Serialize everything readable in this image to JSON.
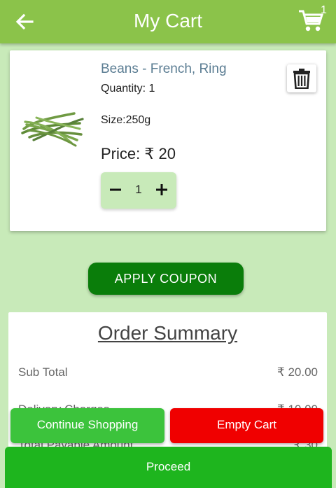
{
  "header": {
    "title": "My Cart",
    "cart_count": "1",
    "back_icon": "arrow-left-icon",
    "cart_icon": "shopping-cart-icon"
  },
  "cart_item": {
    "name": "Beans - French, Ring",
    "quantity_text": "Quantity: 1",
    "size_text": "Size:250g",
    "price_text": "Price: ₹ 20",
    "stepper_value": "1",
    "delete_icon": "trash-icon"
  },
  "coupon": {
    "label": "APPLY COUPON"
  },
  "summary": {
    "title": "Order Summary",
    "rows": [
      {
        "label": "Sub Total",
        "value": "₹ 20.00"
      },
      {
        "label": "Delivery Charges",
        "value": "₹ 10.00"
      },
      {
        "label": "Total Payable Amount",
        "value": "₹ 30"
      }
    ]
  },
  "actions": {
    "continue_label": "Continue Shopping",
    "empty_label": "Empty Cart",
    "proceed_label": "Proceed"
  },
  "colors": {
    "appbar": "#8bc34a",
    "background": "#c8eab9",
    "coupon": "#0a7d0a",
    "continue": "#3cc33c",
    "empty": "#f00000",
    "proceed": "#1eb51e"
  }
}
